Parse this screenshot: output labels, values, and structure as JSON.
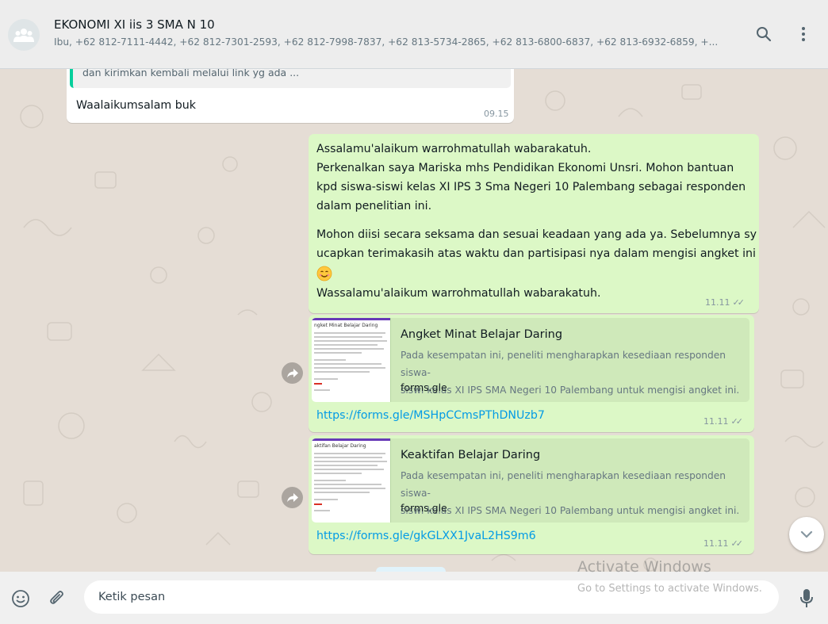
{
  "header": {
    "title": "EKONOMI XI iis 3 SMA N 10",
    "participants": "Ibu, +62 812-7111-4442, +62 812-7301-2593, +62 812-7998-7837, +62 813-5734-2865, +62 813-6800-6837, +62 813-6932-6859, +..."
  },
  "messages": {
    "reply": {
      "quoted_text": "dan kirimkan kembali melalui link yg ada ...",
      "text": "Waalaikumsalam buk",
      "time": "09.15"
    },
    "announcement": {
      "lines": [
        "Assalamu'alaikum warrohmatullah wabarakatuh.",
        "Perkenalkan saya Mariska mhs Pendidikan Ekonomi Unsri. Mohon bantuan",
        "kpd siswa-siswi kelas XI IPS 3 Sma Negeri 10 Palembang sebagai responden",
        "dalam penelitian ini.",
        "Mohon diisi secara seksama dan sesuai keadaan yang ada ya. Sebelumnya sy",
        "ucapkan terimakasih atas waktu dan partisipasi nya dalam mengisi angket ini",
        "Wassalamu'alaikum warrohmatullah wabarakatuh."
      ],
      "time": "11.11"
    },
    "links": [
      {
        "thumb_title": "ngket Minat Belajar Daring",
        "title": "Angket Minat Belajar Daring",
        "desc_line1": "Pada kesempatan ini, peneliti mengharapkan kesediaan responden siswa-",
        "desc_line2": "siswi kelas XI IPS SMA Negeri 10 Palembang untuk mengisi angket ini.",
        "domain": "forms.gle",
        "url": "https://forms.gle/MSHpCCmsPThDNUzb7",
        "time": "11.11"
      },
      {
        "thumb_title": "aktifan Belajar Daring",
        "title": "Keaktifan Belajar Daring",
        "desc_line1": "Pada kesempatan ini, peneliti mengharapkan kesediaan responden siswa-",
        "desc_line2": "siswi kelas XI IPS SMA Negeri 10 Palembang untuk mengisi angket ini.",
        "domain": "forms.gle",
        "url": "https://forms.gle/gkGLXX1JvaL2HS9m6",
        "time": "11.11"
      }
    ]
  },
  "composer": {
    "placeholder": "Ketik pesan"
  },
  "watermark": {
    "title": "Activate Windows",
    "subtitle": "Go to Settings to activate Windows."
  },
  "icons": {
    "avatar": "group-icon",
    "search": "search-icon",
    "menu": "menu-dots-icon",
    "emoji": "emoji-icon",
    "attach": "paperclip-icon",
    "mic": "microphone-icon",
    "forward": "forward-icon",
    "scroll": "chevron-down-icon",
    "emoji_in_message": "smiling-face-emoji"
  },
  "colors": {
    "outgoing_bubble": "#dcf8c6",
    "incoming_bubble": "#ffffff",
    "link": "#039be5",
    "quote_bar": "#06cf9c",
    "chat_background": "#e5ddd5"
  }
}
